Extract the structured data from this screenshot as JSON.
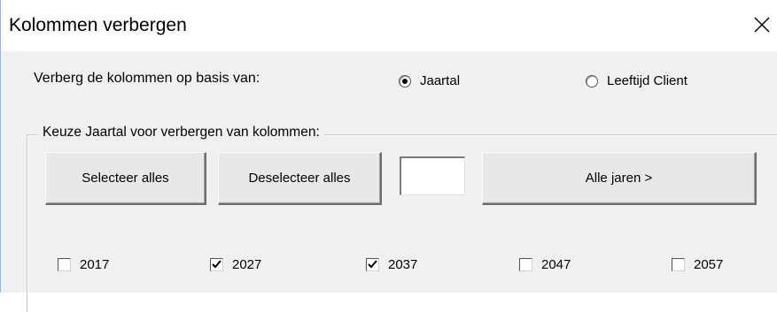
{
  "window": {
    "title": "Kolommen verbergen",
    "close_icon": "close-icon"
  },
  "basis": {
    "label": "Verberg de kolommen op basis van:",
    "options": [
      {
        "label": "Jaartal",
        "selected": true
      },
      {
        "label": "Leeftijd Client",
        "selected": false
      }
    ]
  },
  "frame": {
    "title": "Keuze Jaartal voor verbergen van kolommen:"
  },
  "buttons": {
    "select_all": "Selecteer alles",
    "deselect_all": "Deselecteer alles",
    "all_years": "Alle jaren >"
  },
  "year_input": {
    "value": ""
  },
  "years": [
    {
      "label": "2017",
      "checked": false
    },
    {
      "label": "2027",
      "checked": true
    },
    {
      "label": "2037",
      "checked": true
    },
    {
      "label": "2047",
      "checked": false
    },
    {
      "label": "2057",
      "checked": false
    }
  ]
}
